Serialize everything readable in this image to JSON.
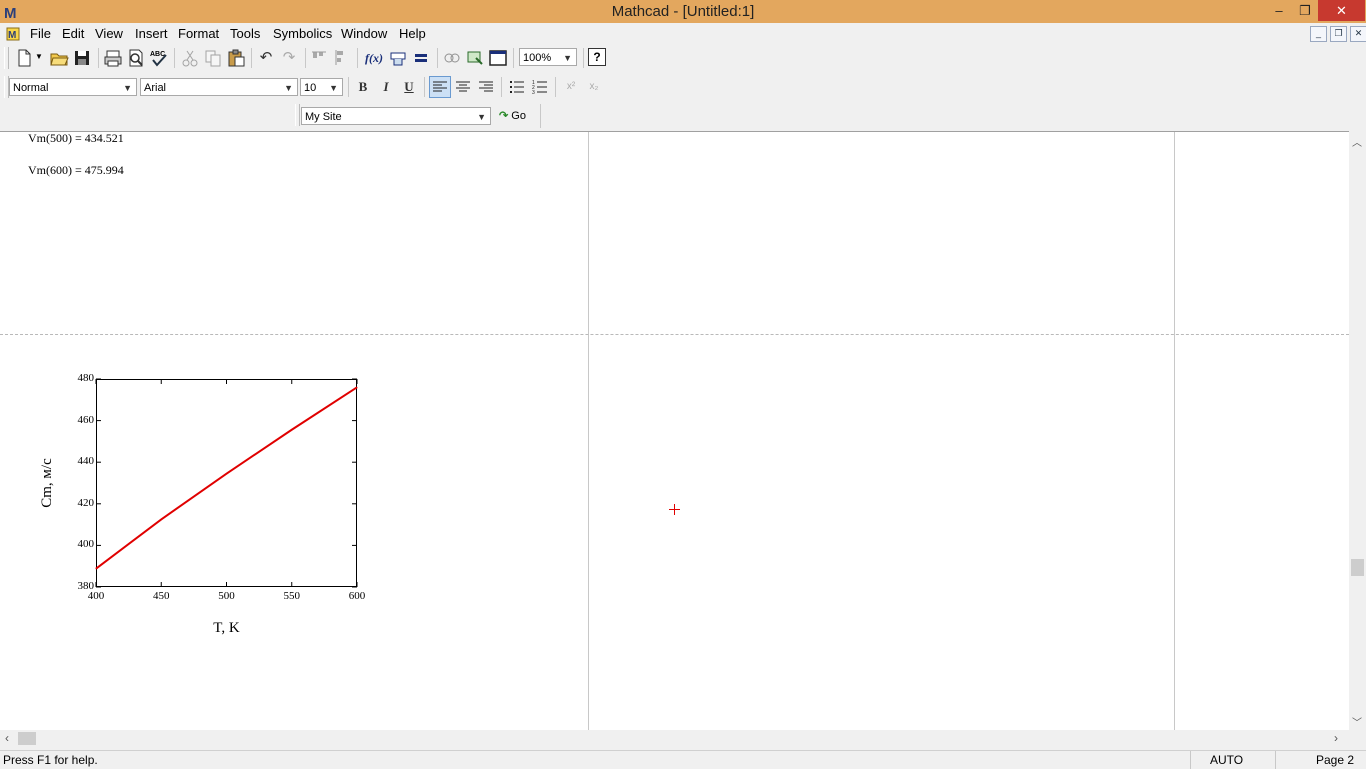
{
  "window": {
    "title": "Mathcad - [Untitled:1]",
    "minimize": "–",
    "restore": "❐",
    "close": "✕"
  },
  "menu": [
    "File",
    "Edit",
    "View",
    "Insert",
    "Format",
    "Tools",
    "Symbolics",
    "Window",
    "Help"
  ],
  "mdi_controls": [
    "_",
    "❐",
    "✕"
  ],
  "toolbar": {
    "zoom": "100%",
    "help_glyph": "?"
  },
  "format_bar": {
    "style": "Normal",
    "font": "Arial",
    "size": "10",
    "bold": "B",
    "italic": "I",
    "underline": "U",
    "superscript": "x²",
    "subscript": "x₂"
  },
  "resources_bar": {
    "site": "My Site",
    "go_label": "Go"
  },
  "worksheet": {
    "results": [
      {
        "expr": "Vm(500) = 434.521"
      },
      {
        "expr": "Vm(600) = 475.994"
      }
    ]
  },
  "chart_data": {
    "type": "line",
    "x": [
      400,
      450,
      500,
      550,
      600
    ],
    "series": [
      {
        "values": [
          388.8,
          412.5,
          434.5,
          455.6,
          476.0
        ],
        "color": "#e00000"
      }
    ],
    "xlabel": "T, K",
    "ylabel": "Cm, м/с",
    "xlim": [
      400,
      600
    ],
    "ylim": [
      380,
      480
    ],
    "xticks": [
      "400",
      "450",
      "500",
      "550",
      "600"
    ],
    "yticks": [
      "380",
      "400",
      "420",
      "440",
      "460",
      "480"
    ],
    "grid": false
  },
  "statusbar": {
    "help": "Press F1 for help.",
    "mode": "AUTO",
    "page": "Page 2"
  }
}
